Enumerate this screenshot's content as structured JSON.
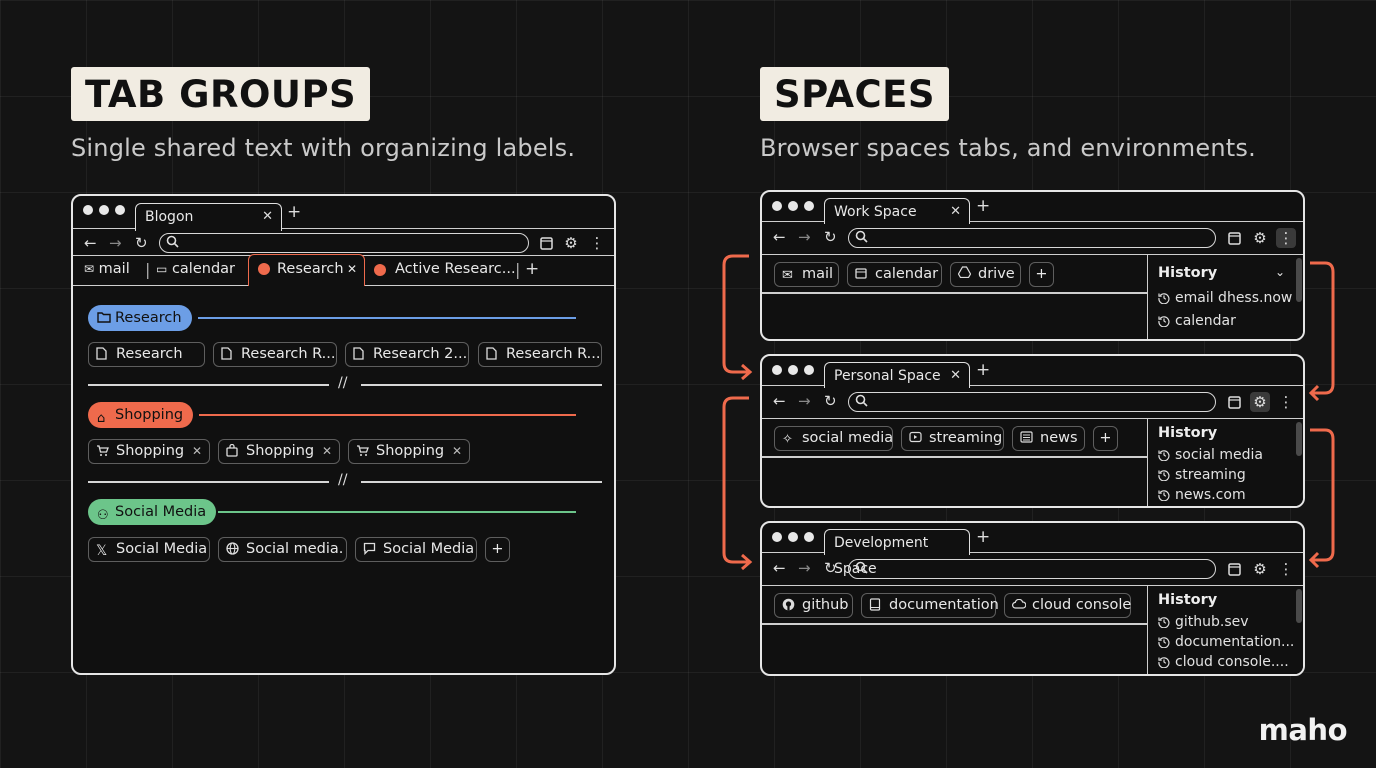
{
  "left": {
    "title": "TAB GROUPS",
    "subtitle": "Single shared text with organizing labels.",
    "window": {
      "tab_title": "Blogon",
      "bookmarks": [
        "mail",
        "calendar",
        "Research",
        "Active Researc..."
      ],
      "groups": [
        {
          "name": "Research",
          "color": "#6c9ee6",
          "tabs": [
            "Research",
            "Research R...",
            "Research 2...",
            "Research R..."
          ]
        },
        {
          "name": "Shopping",
          "color": "#ef6a4c",
          "tabs": [
            "Shopping",
            "Shopping",
            "Shopping"
          ]
        },
        {
          "name": "Social Media",
          "color": "#6cc58a",
          "tabs": [
            "Social Media",
            "Social media.",
            "Social Media"
          ]
        }
      ],
      "separator": "//"
    }
  },
  "right": {
    "title": "SPACES",
    "subtitle": "Browser spaces tabs, and environments.",
    "spaces": [
      {
        "tab_title": "Work Space",
        "chips": [
          "mail",
          "calendar",
          "drive"
        ],
        "history_title": "History",
        "history": [
          "email dhess.now",
          "calendar"
        ]
      },
      {
        "tab_title": "Personal Space",
        "chips": [
          "social media",
          "streaming",
          "news"
        ],
        "history_title": "History",
        "history": [
          "social media",
          "streaming",
          "news.com"
        ]
      },
      {
        "tab_title": "Development Space",
        "chips": [
          "github",
          "documentation",
          "cloud console"
        ],
        "history_title": "History",
        "history": [
          "github.sev",
          "documentation...",
          "cloud console...."
        ]
      }
    ],
    "accent": "#ef6a4c"
  },
  "brand": "maho"
}
